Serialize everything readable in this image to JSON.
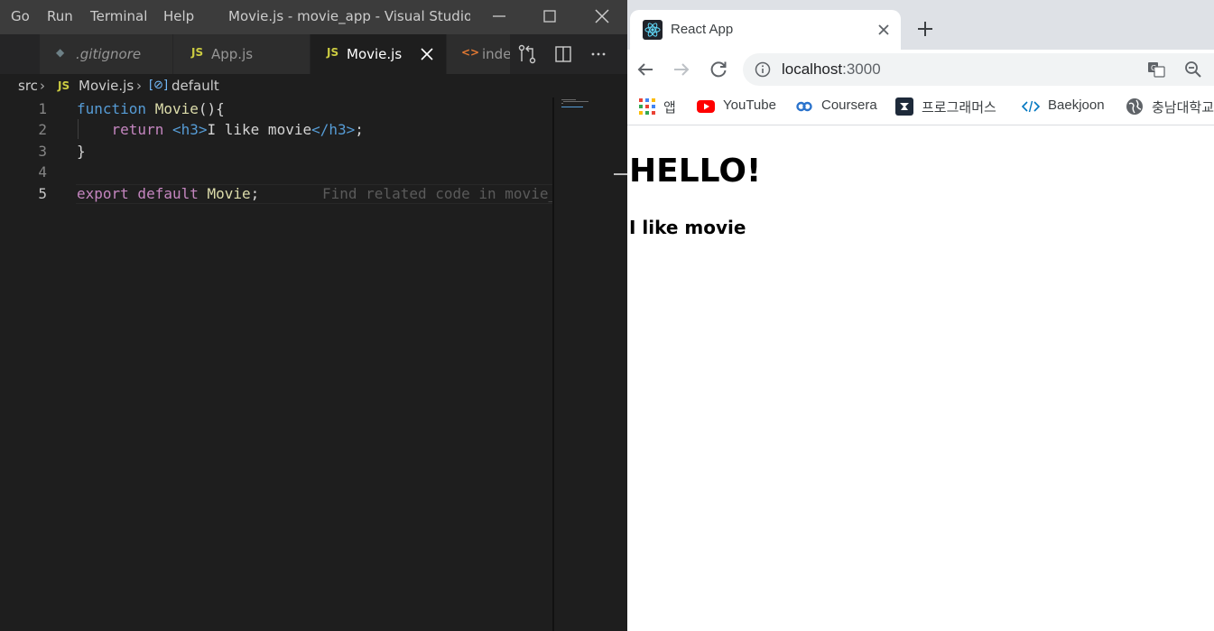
{
  "vscode": {
    "menu": [
      "Go",
      "Run",
      "Terminal",
      "Help"
    ],
    "window_title": "Movie.js - movie_app - Visual Studio C...",
    "tabs": [
      {
        "icon": "◆",
        "label": ".gitignore"
      },
      {
        "icon": "JS",
        "label": "App.js"
      },
      {
        "icon": "JS",
        "label": "Movie.js"
      },
      {
        "icon": "<>",
        "label": "inde"
      }
    ],
    "breadcrumb": {
      "folder": "src",
      "file_icon": "JS",
      "file": "Movie.js",
      "symbol": "default"
    },
    "line_numbers": [
      "1",
      "2",
      "3",
      "4",
      "5"
    ],
    "code": {
      "l1_kw": "function",
      "l1_fn": "Movie",
      "l1_rest": "(){",
      "l2_kw": "return",
      "l2_open": "<h3>",
      "l2_text": "I like movie",
      "l2_close": "</h3>",
      "l2_end": ";",
      "l3": "}",
      "l5_kw": "export default",
      "l5_name": "Movie",
      "l5_end": ";"
    },
    "inline_hint": "Find related code in movie_",
    "accent_colors": {
      "keyword": "#569cd6",
      "control": "#c586c0",
      "function": "#dcdcaa"
    }
  },
  "chrome": {
    "tab_title": "React App",
    "url_host": "localhost",
    "url_port": ":3000",
    "bookmarks": [
      "앱",
      "YouTube",
      "Coursera",
      "프로그래머스",
      "Baekjoon",
      "충남대학교"
    ],
    "page": {
      "heading": "HELLO!",
      "subheading": "I like movie"
    }
  }
}
